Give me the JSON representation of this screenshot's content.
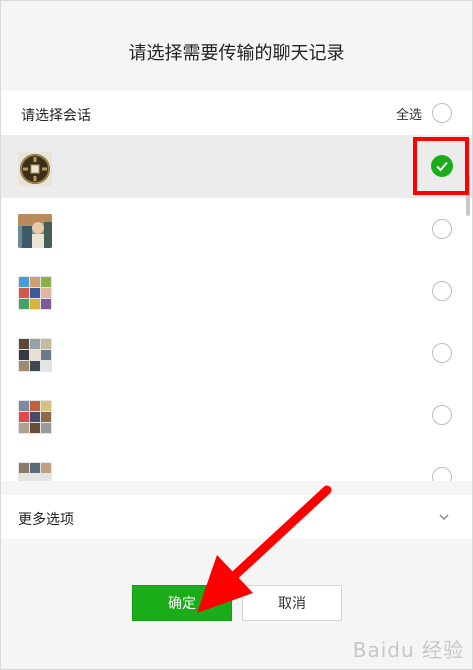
{
  "dialog": {
    "title": "请选择需要传输的聊天记录"
  },
  "selection": {
    "label": "请选择会话",
    "select_all": "全选"
  },
  "conversations": [
    {
      "avatar": "coin-avatar-icon",
      "selected": true
    },
    {
      "avatar": "photo-avatar-icon",
      "selected": false
    },
    {
      "avatar": "group-avatar-icon",
      "selected": false
    },
    {
      "avatar": "group-avatar-icon",
      "selected": false
    },
    {
      "avatar": "group-avatar-icon",
      "selected": false
    },
    {
      "avatar": "group-avatar-icon",
      "selected": false
    }
  ],
  "more_options": {
    "label": "更多选项"
  },
  "buttons": {
    "confirm": "确定",
    "cancel": "取消"
  },
  "watermark": "Baidu 经验",
  "colors": {
    "accent_green": "#1aad19",
    "annotation_red": "#ff0000"
  }
}
